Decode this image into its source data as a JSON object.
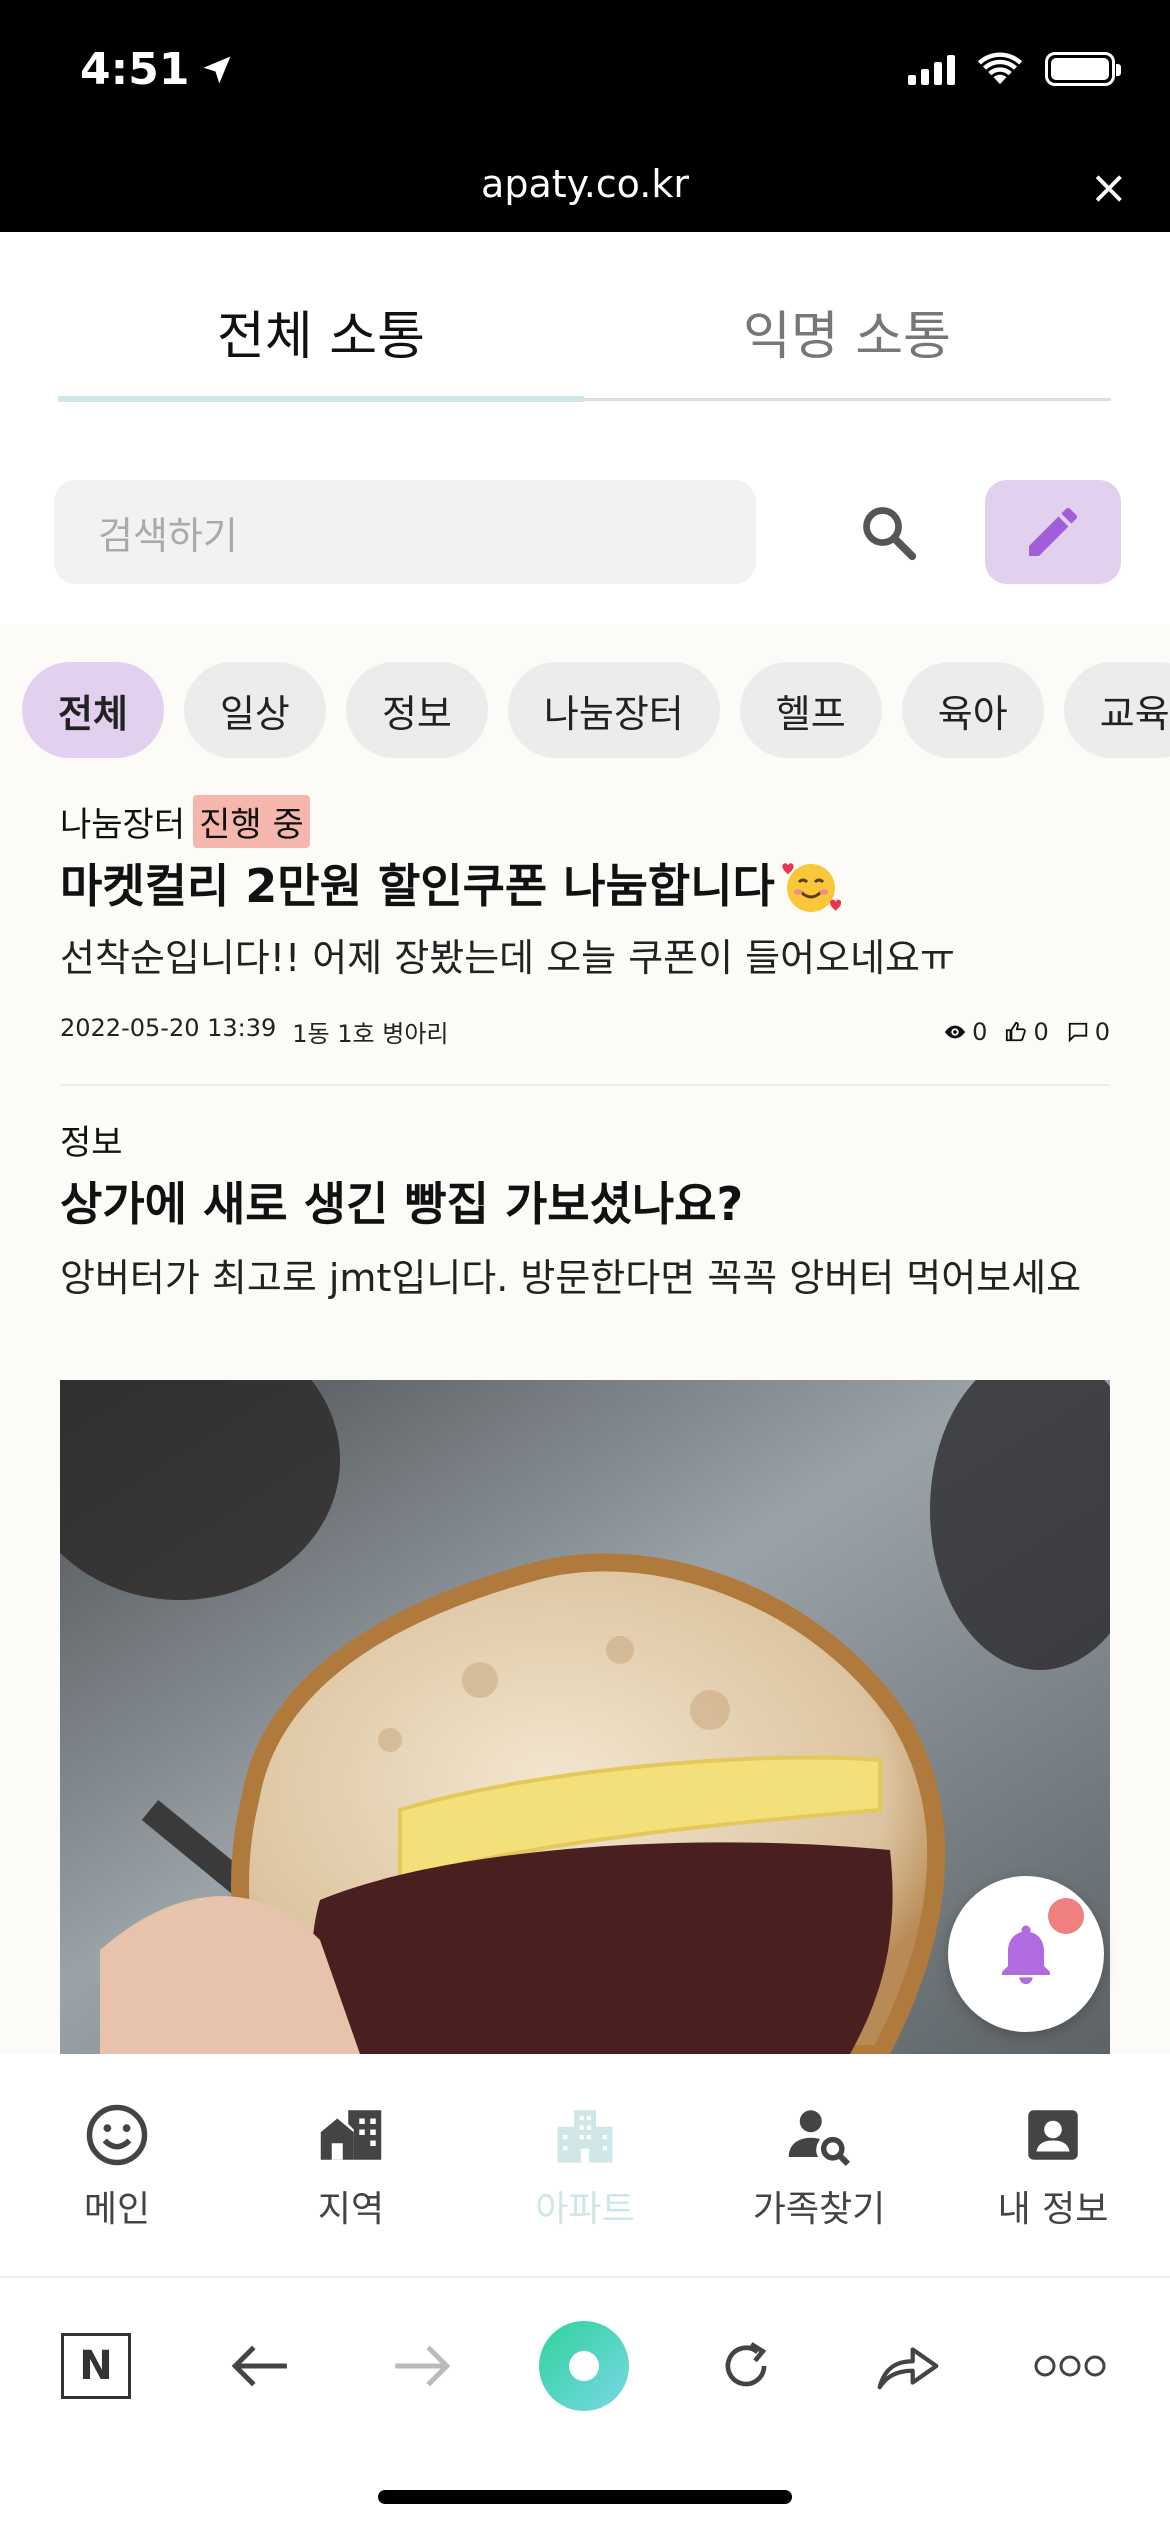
{
  "status_bar": {
    "time": "4:51"
  },
  "url_bar": {
    "domain": "apaty.co.kr",
    "close_glyph": "×"
  },
  "tabs": [
    {
      "label": "전체 소통"
    },
    {
      "label": "익명 소통"
    }
  ],
  "search": {
    "placeholder": "검색하기"
  },
  "categories": [
    "전체",
    "일상",
    "정보",
    "나눔장터",
    "헬프",
    "육아",
    "교육"
  ],
  "posts": [
    {
      "category": "나눔장터",
      "badge": "진행 중",
      "title": "마켓컬리 2만원 할인쿠폰 나눔합니다",
      "body": "선착순입니다!! 어제 장봤는데 오늘 쿠폰이 들어오네요ㅠ",
      "date": "2022-05-20 13:39",
      "author": "1동 1호 병아리",
      "views": "0",
      "likes": "0",
      "comments": "0"
    },
    {
      "category": "정보",
      "title": "상가에 새로 생긴 빵집 가보셨나요?",
      "body": "앙버터가 최고로 jmt입니다. 방문한다면 꼭꼭 앙버터 먹어보세요"
    }
  ],
  "bottom_nav": [
    {
      "label": "메인",
      "icon": "smiley-icon"
    },
    {
      "label": "지역",
      "icon": "city-icon"
    },
    {
      "label": "아파트",
      "icon": "apartment-icon"
    },
    {
      "label": "가족찾기",
      "icon": "person-search-icon"
    },
    {
      "label": "내 정보",
      "icon": "account-box-icon"
    }
  ],
  "browser_toolbar": {
    "n_button": "N"
  },
  "colors": {
    "accent_purple": "#e3d0ee",
    "icon_purple": "#a05fd6",
    "tab_underline": "#cfe6e6",
    "badge": "#f5b7ad",
    "notif_dot": "#f07f7f"
  }
}
